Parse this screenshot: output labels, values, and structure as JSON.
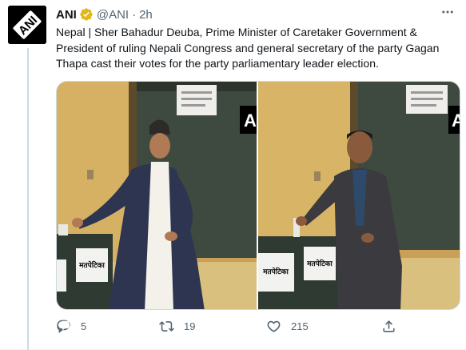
{
  "tweet": {
    "author_name": "ANI",
    "handle": "@ANI",
    "separator": "·",
    "time": "2h",
    "text": "Nepal | Sher Bahadur Deuba, Prime Minister of Caretaker Government & President of ruling Nepali Congress and general secretary of the party Gagan Thapa cast their votes for the party parliamentary leader election.",
    "avatar_text": "ANI",
    "media": {
      "photo_1": {
        "ballot_box_label": "मतपेटिका",
        "watermark": "A"
      },
      "photo_2": {
        "ballot_box_label": "मतपेटिका",
        "watermark": "A"
      }
    },
    "actions": {
      "reply_count": "5",
      "retweet_count": "19",
      "like_count": "215"
    }
  },
  "colors": {
    "text_primary": "#0f1419",
    "text_secondary": "#536471",
    "verified_badge": "#e2b719",
    "divider": "#cfd9de"
  },
  "icons": [
    "verified-badge-icon",
    "more-icon",
    "reply-icon",
    "retweet-icon",
    "like-icon",
    "share-icon"
  ]
}
